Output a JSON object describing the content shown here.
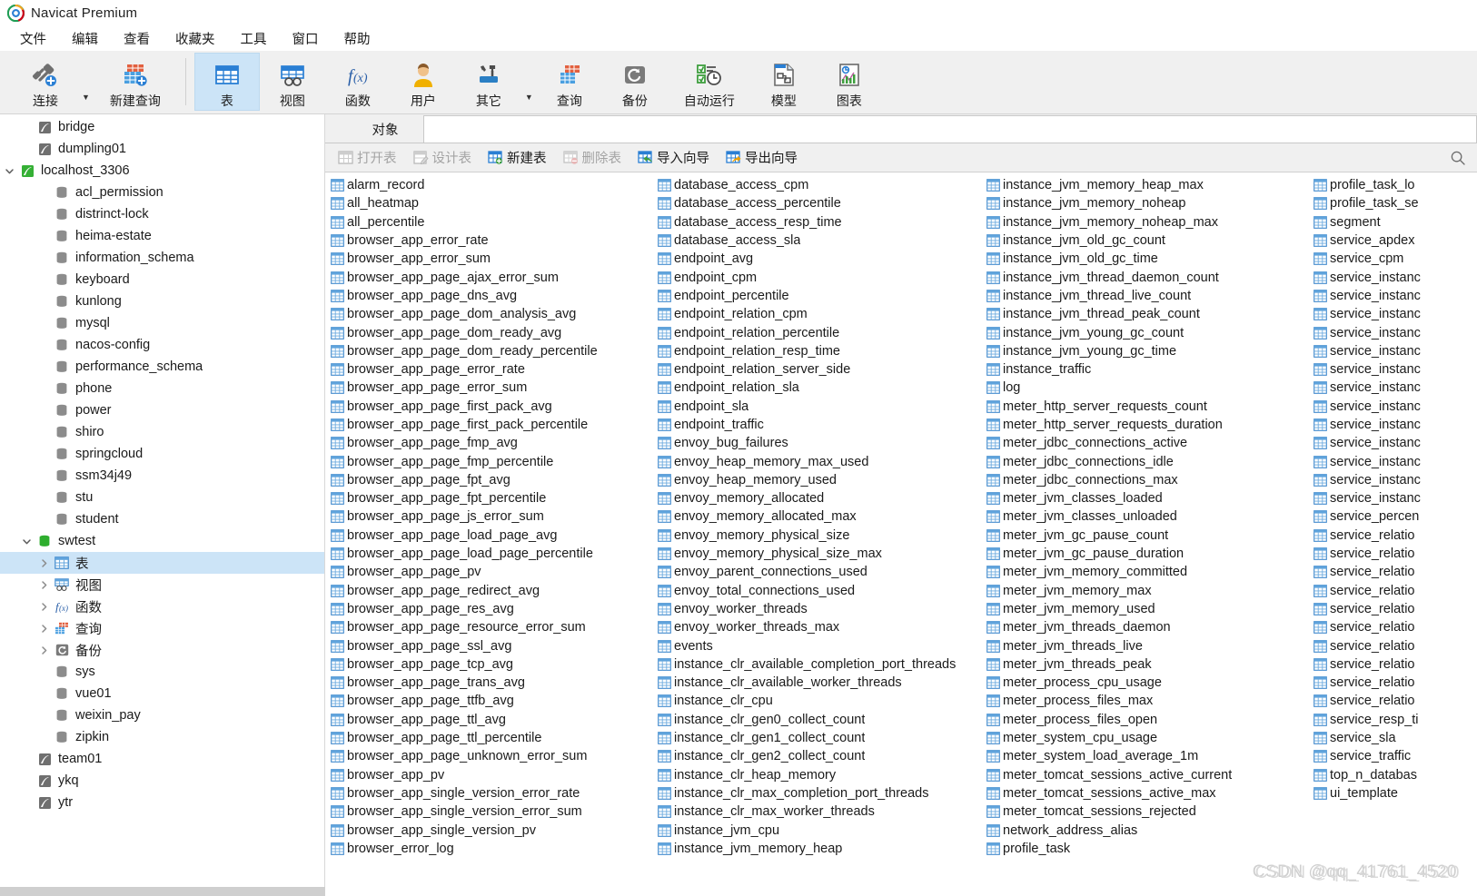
{
  "window": {
    "title": "Navicat Premium",
    "logo_icon": "navicat-logo-icon"
  },
  "menubar": {
    "items": [
      {
        "label": "文件",
        "name": "menu-file"
      },
      {
        "label": "编辑",
        "name": "menu-edit"
      },
      {
        "label": "查看",
        "name": "menu-view"
      },
      {
        "label": "收藏夹",
        "name": "menu-favorites"
      },
      {
        "label": "工具",
        "name": "menu-tools"
      },
      {
        "label": "窗口",
        "name": "menu-window"
      },
      {
        "label": "帮助",
        "name": "menu-help"
      }
    ]
  },
  "toolbar": {
    "buttons": [
      {
        "label": "连接",
        "icon": "connection-icon",
        "name": "toolbar-connection",
        "active": false,
        "caret": true
      },
      {
        "label": "新建查询",
        "icon": "new-query-icon",
        "name": "toolbar-new-query",
        "active": false,
        "caret": false
      },
      {
        "label": "表",
        "icon": "table-icon",
        "name": "toolbar-table",
        "active": true,
        "caret": false
      },
      {
        "label": "视图",
        "icon": "view-icon",
        "name": "toolbar-view",
        "active": false,
        "caret": false
      },
      {
        "label": "函数",
        "icon": "function-icon",
        "name": "toolbar-function",
        "active": false,
        "caret": false
      },
      {
        "label": "用户",
        "icon": "user-icon",
        "name": "toolbar-user",
        "active": false,
        "caret": false
      },
      {
        "label": "其它",
        "icon": "other-tools-icon",
        "name": "toolbar-other",
        "active": false,
        "caret": true
      },
      {
        "label": "查询",
        "icon": "query-icon",
        "name": "toolbar-query",
        "active": false,
        "caret": false
      },
      {
        "label": "备份",
        "icon": "backup-icon",
        "name": "toolbar-backup",
        "active": false,
        "caret": false
      },
      {
        "label": "自动运行",
        "icon": "automation-icon",
        "name": "toolbar-automation",
        "active": false,
        "caret": false
      },
      {
        "label": "模型",
        "icon": "model-icon",
        "name": "toolbar-model",
        "active": false,
        "caret": false
      },
      {
        "label": "图表",
        "icon": "chart-icon",
        "name": "toolbar-chart",
        "active": false,
        "caret": false
      }
    ]
  },
  "sidebar": {
    "nodes": [
      {
        "label": "bridge",
        "icon": "connection-gray-icon",
        "indent": 1,
        "twisty": "",
        "selected": false
      },
      {
        "label": "dumpling01",
        "icon": "connection-gray-icon",
        "indent": 1,
        "twisty": "",
        "selected": false
      },
      {
        "label": "localhost_3306",
        "icon": "connection-green-icon",
        "indent": 0,
        "twisty": "expanded",
        "selected": false
      },
      {
        "label": "acl_permission",
        "icon": "database-gray-icon",
        "indent": 2,
        "twisty": "",
        "selected": false
      },
      {
        "label": "distrinct-lock",
        "icon": "database-gray-icon",
        "indent": 2,
        "twisty": "",
        "selected": false
      },
      {
        "label": "heima-estate",
        "icon": "database-gray-icon",
        "indent": 2,
        "twisty": "",
        "selected": false
      },
      {
        "label": "information_schema",
        "icon": "database-gray-icon",
        "indent": 2,
        "twisty": "",
        "selected": false
      },
      {
        "label": "keyboard",
        "icon": "database-gray-icon",
        "indent": 2,
        "twisty": "",
        "selected": false
      },
      {
        "label": "kunlong",
        "icon": "database-gray-icon",
        "indent": 2,
        "twisty": "",
        "selected": false
      },
      {
        "label": "mysql",
        "icon": "database-gray-icon",
        "indent": 2,
        "twisty": "",
        "selected": false
      },
      {
        "label": "nacos-config",
        "icon": "database-gray-icon",
        "indent": 2,
        "twisty": "",
        "selected": false
      },
      {
        "label": "performance_schema",
        "icon": "database-gray-icon",
        "indent": 2,
        "twisty": "",
        "selected": false
      },
      {
        "label": "phone",
        "icon": "database-gray-icon",
        "indent": 2,
        "twisty": "",
        "selected": false
      },
      {
        "label": "power",
        "icon": "database-gray-icon",
        "indent": 2,
        "twisty": "",
        "selected": false
      },
      {
        "label": "shiro",
        "icon": "database-gray-icon",
        "indent": 2,
        "twisty": "",
        "selected": false
      },
      {
        "label": "springcloud",
        "icon": "database-gray-icon",
        "indent": 2,
        "twisty": "",
        "selected": false
      },
      {
        "label": "ssm34j49",
        "icon": "database-gray-icon",
        "indent": 2,
        "twisty": "",
        "selected": false
      },
      {
        "label": "stu",
        "icon": "database-gray-icon",
        "indent": 2,
        "twisty": "",
        "selected": false
      },
      {
        "label": "student",
        "icon": "database-gray-icon",
        "indent": 2,
        "twisty": "",
        "selected": false
      },
      {
        "label": "swtest",
        "icon": "database-green-icon",
        "indent": 1,
        "twisty": "expanded",
        "selected": false
      },
      {
        "label": "表",
        "icon": "table-icon",
        "indent": 2,
        "twisty": "collapsed",
        "selected": true
      },
      {
        "label": "视图",
        "icon": "view-icon",
        "indent": 2,
        "twisty": "collapsed",
        "selected": false
      },
      {
        "label": "函数",
        "icon": "function-icon",
        "indent": 2,
        "twisty": "collapsed",
        "selected": false
      },
      {
        "label": "查询",
        "icon": "query-icon",
        "indent": 2,
        "twisty": "collapsed",
        "selected": false
      },
      {
        "label": "备份",
        "icon": "backup-icon",
        "indent": 2,
        "twisty": "collapsed",
        "selected": false
      },
      {
        "label": "sys",
        "icon": "database-gray-icon",
        "indent": 2,
        "twisty": "",
        "selected": false
      },
      {
        "label": "vue01",
        "icon": "database-gray-icon",
        "indent": 2,
        "twisty": "",
        "selected": false
      },
      {
        "label": "weixin_pay",
        "icon": "database-gray-icon",
        "indent": 2,
        "twisty": "",
        "selected": false
      },
      {
        "label": "zipkin",
        "icon": "database-gray-icon",
        "indent": 2,
        "twisty": "",
        "selected": false
      },
      {
        "label": "team01",
        "icon": "connection-gray-icon",
        "indent": 1,
        "twisty": "",
        "selected": false
      },
      {
        "label": "ykq",
        "icon": "connection-gray-icon",
        "indent": 1,
        "twisty": "",
        "selected": false
      },
      {
        "label": "ytr",
        "icon": "connection-gray-icon",
        "indent": 1,
        "twisty": "",
        "selected": false
      }
    ]
  },
  "tabs": [
    {
      "label": "对象",
      "name": "tab-objects",
      "active": true
    }
  ],
  "object_toolbar": {
    "buttons": [
      {
        "label": "打开表",
        "icon": "open-table-icon",
        "name": "open-table-button",
        "disabled": true
      },
      {
        "label": "设计表",
        "icon": "design-table-icon",
        "name": "design-table-button",
        "disabled": true
      },
      {
        "label": "新建表",
        "icon": "new-table-icon",
        "name": "new-table-button",
        "disabled": false
      },
      {
        "label": "删除表",
        "icon": "delete-table-icon",
        "name": "delete-table-button",
        "disabled": true
      },
      {
        "label": "导入向导",
        "icon": "import-wizard-icon",
        "name": "import-wizard-button",
        "disabled": false
      },
      {
        "label": "导出向导",
        "icon": "export-wizard-icon",
        "name": "export-wizard-button",
        "disabled": false
      }
    ],
    "search_icon": "search-icon"
  },
  "object_list": {
    "columns": [
      [
        "alarm_record",
        "all_heatmap",
        "all_percentile",
        "browser_app_error_rate",
        "browser_app_error_sum",
        "browser_app_page_ajax_error_sum",
        "browser_app_page_dns_avg",
        "browser_app_page_dom_analysis_avg",
        "browser_app_page_dom_ready_avg",
        "browser_app_page_dom_ready_percentile",
        "browser_app_page_error_rate",
        "browser_app_page_error_sum",
        "browser_app_page_first_pack_avg",
        "browser_app_page_first_pack_percentile",
        "browser_app_page_fmp_avg",
        "browser_app_page_fmp_percentile",
        "browser_app_page_fpt_avg",
        "browser_app_page_fpt_percentile",
        "browser_app_page_js_error_sum",
        "browser_app_page_load_page_avg",
        "browser_app_page_load_page_percentile",
        "browser_app_page_pv",
        "browser_app_page_redirect_avg",
        "browser_app_page_res_avg",
        "browser_app_page_resource_error_sum",
        "browser_app_page_ssl_avg",
        "browser_app_page_tcp_avg",
        "browser_app_page_trans_avg",
        "browser_app_page_ttfb_avg",
        "browser_app_page_ttl_avg",
        "browser_app_page_ttl_percentile",
        "browser_app_page_unknown_error_sum",
        "browser_app_pv",
        "browser_app_single_version_error_rate",
        "browser_app_single_version_error_sum",
        "browser_app_single_version_pv",
        "browser_error_log"
      ],
      [
        "database_access_cpm",
        "database_access_percentile",
        "database_access_resp_time",
        "database_access_sla",
        "endpoint_avg",
        "endpoint_cpm",
        "endpoint_percentile",
        "endpoint_relation_cpm",
        "endpoint_relation_percentile",
        "endpoint_relation_resp_time",
        "endpoint_relation_server_side",
        "endpoint_relation_sla",
        "endpoint_sla",
        "endpoint_traffic",
        "envoy_bug_failures",
        "envoy_heap_memory_max_used",
        "envoy_heap_memory_used",
        "envoy_memory_allocated",
        "envoy_memory_allocated_max",
        "envoy_memory_physical_size",
        "envoy_memory_physical_size_max",
        "envoy_parent_connections_used",
        "envoy_total_connections_used",
        "envoy_worker_threads",
        "envoy_worker_threads_max",
        "events",
        "instance_clr_available_completion_port_threads",
        "instance_clr_available_worker_threads",
        "instance_clr_cpu",
        "instance_clr_gen0_collect_count",
        "instance_clr_gen1_collect_count",
        "instance_clr_gen2_collect_count",
        "instance_clr_heap_memory",
        "instance_clr_max_completion_port_threads",
        "instance_clr_max_worker_threads",
        "instance_jvm_cpu",
        "instance_jvm_memory_heap"
      ],
      [
        "instance_jvm_memory_heap_max",
        "instance_jvm_memory_noheap",
        "instance_jvm_memory_noheap_max",
        "instance_jvm_old_gc_count",
        "instance_jvm_old_gc_time",
        "instance_jvm_thread_daemon_count",
        "instance_jvm_thread_live_count",
        "instance_jvm_thread_peak_count",
        "instance_jvm_young_gc_count",
        "instance_jvm_young_gc_time",
        "instance_traffic",
        "log",
        "meter_http_server_requests_count",
        "meter_http_server_requests_duration",
        "meter_jdbc_connections_active",
        "meter_jdbc_connections_idle",
        "meter_jdbc_connections_max",
        "meter_jvm_classes_loaded",
        "meter_jvm_classes_unloaded",
        "meter_jvm_gc_pause_count",
        "meter_jvm_gc_pause_duration",
        "meter_jvm_memory_committed",
        "meter_jvm_memory_max",
        "meter_jvm_memory_used",
        "meter_jvm_threads_daemon",
        "meter_jvm_threads_live",
        "meter_jvm_threads_peak",
        "meter_process_cpu_usage",
        "meter_process_files_max",
        "meter_process_files_open",
        "meter_system_cpu_usage",
        "meter_system_load_average_1m",
        "meter_tomcat_sessions_active_current",
        "meter_tomcat_sessions_active_max",
        "meter_tomcat_sessions_rejected",
        "network_address_alias",
        "profile_task"
      ],
      [
        "profile_task_lo",
        "profile_task_se",
        "segment",
        "service_apdex",
        "service_cpm",
        "service_instanc",
        "service_instanc",
        "service_instanc",
        "service_instanc",
        "service_instanc",
        "service_instanc",
        "service_instanc",
        "service_instanc",
        "service_instanc",
        "service_instanc",
        "service_instanc",
        "service_instanc",
        "service_instanc",
        "service_percen",
        "service_relatio",
        "service_relatio",
        "service_relatio",
        "service_relatio",
        "service_relatio",
        "service_relatio",
        "service_relatio",
        "service_relatio",
        "service_relatio",
        "service_relatio",
        "service_resp_ti",
        "service_sla",
        "service_traffic",
        "top_n_databas",
        "ui_template"
      ]
    ]
  },
  "watermark": {
    "text": "CSDN @qq_41761_4520"
  }
}
